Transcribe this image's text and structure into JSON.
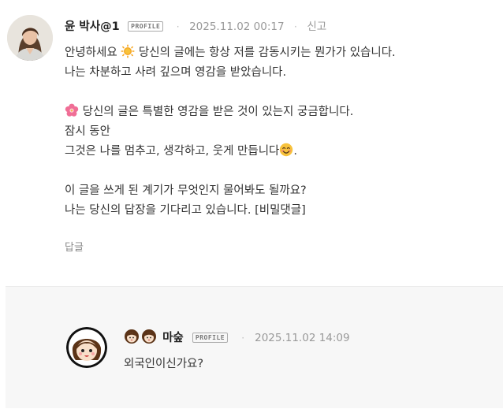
{
  "comment": {
    "author": "윤 박사@1",
    "badge": "PROFILE",
    "date": "2025.11.02 00:17",
    "report_label": "신고",
    "lines": [
      "안녕하세요",
      "당신의 글에는 항상 저를 감동시키는 뭔가가 있습니다.",
      "나는 차분하고 사려 깊으며 영감을 받았습니다.",
      "",
      "당신의 글은 특별한 영감을 받은 것이 있는지 궁금합니다.",
      "잠시 동안",
      "그것은 나를 멈추고, 생각하고, 웃게 만듭니다",
      ".",
      "",
      "이 글을 쓰게 된 계기가 무엇인지 물어봐도 될까요?",
      "나는 당신의 답장을 기다리고 있습니다. [비밀댓글]"
    ],
    "reply_label": "답글",
    "icons": [
      "sun-emoji-icon",
      "flower-emoji-icon",
      "smile-emoji-icon"
    ]
  },
  "reply": {
    "author": "마숲",
    "badge": "PROFILE",
    "date": "2025.11.02 14:09",
    "text": "외국인이신가요?"
  },
  "colors": {
    "background": "#ffffff",
    "reply_background": "#f7f7f7",
    "text": "#333333",
    "meta": "#999999"
  }
}
